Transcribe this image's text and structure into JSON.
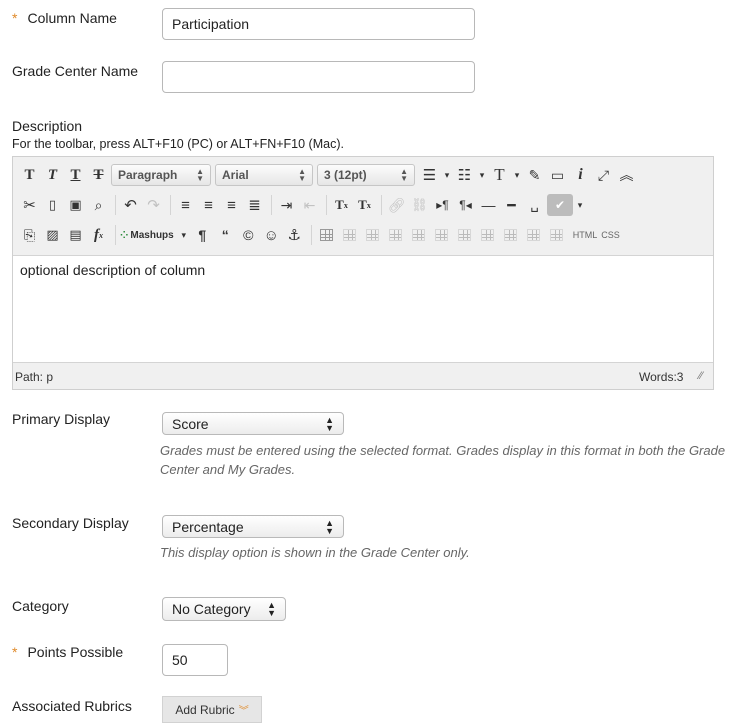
{
  "column_name": {
    "label": "Column Name",
    "required_mark": "*",
    "value": "Participation"
  },
  "grade_center_name": {
    "label": "Grade Center Name",
    "value": ""
  },
  "description": {
    "label": "Description",
    "toolbar_hint": "For the toolbar, press ALT+F10 (PC) or ALT+FN+F10 (Mac).",
    "paragraph_select": "Paragraph",
    "font_select": "Arial",
    "size_select": "3 (12pt)",
    "mashups_label": "Mashups",
    "html_label": "HTML",
    "css_label": "CSS",
    "content": "optional description of column",
    "path_label": "Path: p",
    "words_label": "Words:3"
  },
  "primary_display": {
    "label": "Primary Display",
    "selected": "Score",
    "hint": "Grades must be entered using the selected format. Grades display in this format in both the Grade Center and My Grades."
  },
  "secondary_display": {
    "label": "Secondary Display",
    "selected": "Percentage",
    "hint": "This display option is shown in the Grade Center only."
  },
  "category": {
    "label": "Category",
    "selected": "No Category"
  },
  "points_possible": {
    "label": "Points Possible",
    "required_mark": "*",
    "value": "50"
  },
  "associated_rubrics": {
    "label": "Associated Rubrics",
    "button_label": "Add Rubric"
  },
  "colors": {
    "required": "#e08a2a",
    "hint_text": "#666666",
    "editor_bg": "#f0f0f0"
  }
}
